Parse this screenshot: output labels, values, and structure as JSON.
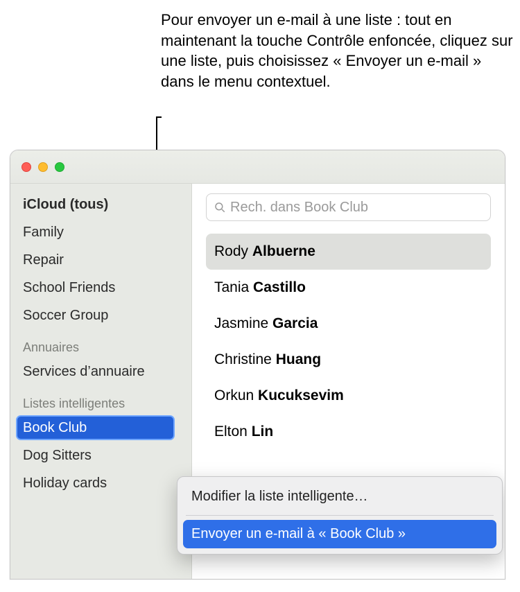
{
  "callout": {
    "text": "Pour envoyer un e-mail à une liste : tout en maintenant la touche Contrôle enfoncée, cliquez sur une liste, puis choisissez « Envoyer un e-mail » dans le menu contextuel."
  },
  "sidebar": {
    "groups": {
      "icloud": [
        {
          "label": "iCloud (tous)",
          "bold": true
        },
        {
          "label": "Family"
        },
        {
          "label": "Repair"
        },
        {
          "label": "School Friends"
        },
        {
          "label": "Soccer Group"
        }
      ],
      "directories_header": "Annuaires",
      "directories": [
        {
          "label": "Services d’annuaire"
        }
      ],
      "smart_header": "Listes intelligentes",
      "smart": [
        {
          "label": "Book Club",
          "selected": true
        },
        {
          "label": "Dog Sitters"
        },
        {
          "label": "Holiday cards"
        }
      ]
    }
  },
  "search": {
    "placeholder": "Rech. dans Book Club"
  },
  "contacts": [
    {
      "first": "Rody",
      "last": "Albuerne",
      "selected": true
    },
    {
      "first": "Tania",
      "last": "Castillo"
    },
    {
      "first": "Jasmine",
      "last": "Garcia"
    },
    {
      "first": "Christine",
      "last": "Huang"
    },
    {
      "first": "Orkun",
      "last": "Kucuksevim"
    },
    {
      "first": "Elton",
      "last": "Lin"
    }
  ],
  "context_menu": {
    "items": [
      {
        "label": "Modifier la liste intelligente…",
        "highlighted": false
      },
      {
        "label": "Envoyer un e-mail à « Book Club »",
        "highlighted": true
      }
    ]
  }
}
